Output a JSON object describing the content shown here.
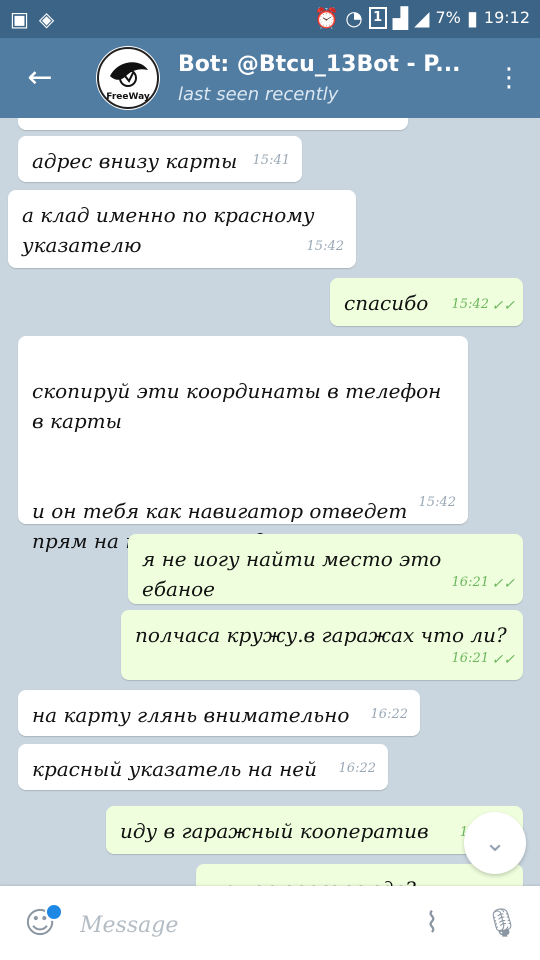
{
  "status_bar": {
    "sim": "1",
    "battery": "7%",
    "time": "19:12"
  },
  "header": {
    "title": "Bot: @Btcu_13Bot - P...",
    "status": "last seen recently",
    "avatar_label": "FreeWay"
  },
  "messages": [
    {
      "text": "адрес внизу карты",
      "time": "15:41"
    },
    {
      "text": "а клад именно по красному указателю",
      "time": "15:42"
    },
    {
      "text": "спасибо",
      "time": "15:42"
    },
    {
      "text": "скопируй эти координаты в телефон в карты\n\n\nи он тебя как навигатор отведет прям на точку с кладом",
      "time": "15:42"
    },
    {
      "text": "я не иогу найти место это ебаное",
      "time": "16:21"
    },
    {
      "text": "полчаса кружу.в гаражах что ли?",
      "time": "16:21"
    },
    {
      "text": "на карту глянь внимательно",
      "time": "16:22"
    },
    {
      "text": "красный указатель на ней",
      "time": "16:22"
    },
    {
      "text": "иду в гаражный кооператив",
      "time": "16:2"
    },
    {
      "text": "номер гаража где?",
      "time": ""
    }
  ],
  "composer": {
    "placeholder": "Message"
  }
}
